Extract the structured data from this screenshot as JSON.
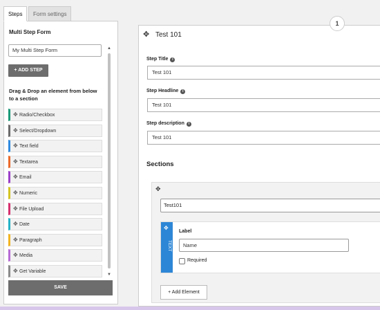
{
  "tabs": [
    {
      "label": "Steps"
    },
    {
      "label": "Form settings"
    }
  ],
  "left": {
    "title": "Multi Step Form",
    "form_name": "My Multi Step Form",
    "add_step_label": "ADD STEP",
    "instructions": "Drag & Drop an element from below to a section",
    "elements": [
      {
        "label": "Radio/Checkbox",
        "color": "#1a9a78"
      },
      {
        "label": "Select/Dropdown",
        "color": "#6b6b6b"
      },
      {
        "label": "Text field",
        "color": "#2f8ae0"
      },
      {
        "label": "Textarea",
        "color": "#ec6a2b"
      },
      {
        "label": "Email",
        "color": "#9b3fc9"
      },
      {
        "label": "Numeric",
        "color": "#d4c422"
      },
      {
        "label": "File Upload",
        "color": "#d62f6e"
      },
      {
        "label": "Date",
        "color": "#24b3c6"
      },
      {
        "label": "Paragraph",
        "color": "#f2b421"
      },
      {
        "label": "Media",
        "color": "#b86ad6"
      },
      {
        "label": "Get Variable",
        "color": "#8a8a8a"
      }
    ],
    "save_label": "SAVE"
  },
  "step": {
    "number": "1",
    "name": "Test 101",
    "fields": [
      {
        "label": "Step Title",
        "value": "Test 101"
      },
      {
        "label": "Step Headline",
        "value": "Test 101"
      },
      {
        "label": "Step description",
        "value": "Test 101"
      }
    ]
  },
  "sections": {
    "title": "Sections",
    "section_name": "Test101",
    "element": {
      "type": "TEXT",
      "label": "Label",
      "input_value": "Name",
      "required_label": "Required",
      "required": false
    },
    "add_element_label": "+ Add Element"
  },
  "colors": {
    "button_gray": "#6d6d6d",
    "element_blue": "#2d86d6"
  }
}
